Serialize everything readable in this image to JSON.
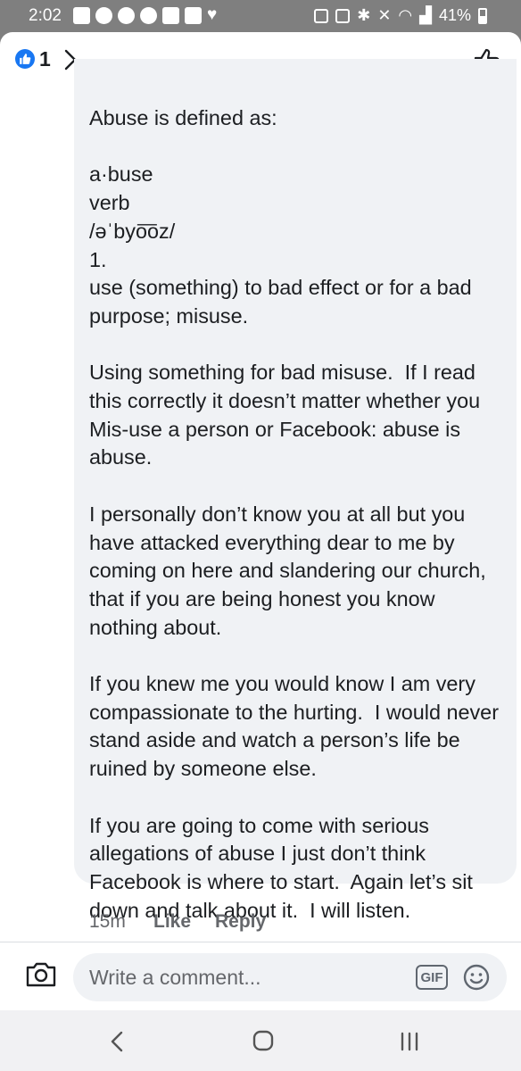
{
  "status_bar": {
    "time": "2:02",
    "battery": "41%"
  },
  "header": {
    "like_count": "1"
  },
  "comment": {
    "text": "Abuse is defined as:\n\na·buse\nverb\n/əˈbyo͞oz/\n1.\nuse (something) to bad effect or for a bad purpose; misuse.\n\nUsing something for bad misuse.  If I read this correctly it doesn’t matter whether you Mis-use a person or Facebook: abuse is abuse.\n\nI personally don’t know you at all but you have attacked everything dear to me by coming on here and slandering our church, that if you are being honest you know nothing about.\n\nIf you knew me you would know I am very compassionate to the hurting.  I would never stand aside and watch a person’s life be ruined by someone else.\n\nIf you are going to come with serious allegations of abuse I just don’t think Facebook is where to start.  Again let’s sit down and talk about it.  I will listen.",
    "time": "15m",
    "like_label": "Like",
    "reply_label": "Reply"
  },
  "composer": {
    "placeholder": "Write a comment...",
    "gif_label": "GIF"
  },
  "colors": {
    "accent": "#1877f2",
    "bubble": "#f0f2f5",
    "text": "#1c1e21",
    "meta": "#65676b"
  }
}
